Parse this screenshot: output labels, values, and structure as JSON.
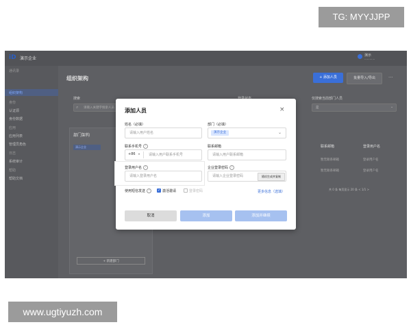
{
  "watermarks": {
    "tg": "TG: MYYJJPP",
    "site": "www.ugtiyuzh.com"
  },
  "topbar": {
    "logo": "iD",
    "company": "演示企业",
    "user_name": "演示",
    "user_sub": "············"
  },
  "sidebar": {
    "items": [
      {
        "label": "通讯录",
        "kind": "group"
      },
      {
        "label": "组织架构",
        "kind": "active"
      },
      {
        "label": "身份",
        "kind": "group"
      },
      {
        "label": "认证源",
        "kind": "item"
      },
      {
        "label": "身份数据",
        "kind": "item"
      },
      {
        "label": "应用",
        "kind": "group"
      },
      {
        "label": "应用列表",
        "kind": "item"
      },
      {
        "label": "管理员角色",
        "kind": "item"
      },
      {
        "label": "日志",
        "kind": "group"
      },
      {
        "label": "系统审计",
        "kind": "item"
      },
      {
        "label": "帮助",
        "kind": "group"
      },
      {
        "label": "帮助文档",
        "kind": "item"
      }
    ]
  },
  "main": {
    "title": "组织架构",
    "add_button": "+ 添加人员",
    "batch_button": "批量导入/导出",
    "more": "···",
    "search_label": "搜索",
    "search_placeholder": "请输入关键字搜索人员",
    "filter2_label": "登录状态",
    "filter3_label": "仅搜索当前部门人员",
    "filter3_value": "是",
    "dept_panel_title": "部门架构",
    "dept_root": "演示企业",
    "add_dept": "+ 新建部门",
    "columns": [
      "联系邮箱",
      "登录用户名"
    ],
    "rows": [
      [
        "暂无联系邮箱",
        "登录用户名"
      ],
      [
        "暂无联系邮箱",
        "登录用户名"
      ]
    ],
    "pager": "共 0 条  每页显示 20 条  < 1/1 >"
  },
  "dialog": {
    "title": "添加人员",
    "close": "×",
    "name_label": "姓名（必填）",
    "name_placeholder": "请输入用户姓名",
    "dept_label": "部门（必填）",
    "dept_tag": "演示企业",
    "phone_label": "联系手机号",
    "phone_prefix": "+86",
    "phone_placeholder": "请输入用户联系手机号",
    "email_label": "联系邮箱",
    "email_placeholder": "请输入用户联系邮箱",
    "username_label": "登录用户名",
    "username_placeholder": "请输入登录用户名",
    "password_label": "企业登录密码",
    "password_placeholder": "请输入企业登录密码",
    "generate_button": "随机生成并复制",
    "sms_label": "使用短信发送",
    "activation_label": "激活邀请",
    "activation_checked": true,
    "password_option_label": "登录密码",
    "password_option_checked": false,
    "more_link": "更多信息（选填）",
    "cancel_button": "取消",
    "save_button": "添加",
    "save_next_button": "添加并继续"
  },
  "colors": {
    "accent": "#3a6fd8",
    "overlay": "#5e5f63",
    "dialog_bg": "#ffffff"
  }
}
